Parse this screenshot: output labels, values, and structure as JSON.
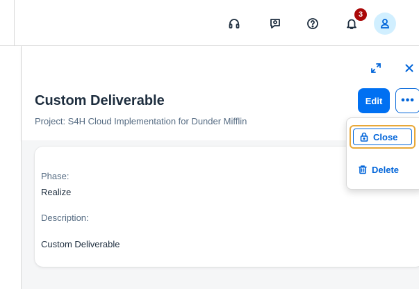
{
  "shellbar": {
    "icons": [
      "headset-icon",
      "feedback-icon",
      "help-icon",
      "notification-bell-icon",
      "user-avatar-icon"
    ],
    "notification_count": "3"
  },
  "header": {
    "title": "Custom Deliverable",
    "subtitle": "Project:  S4H Cloud Implementation for Dunder Mifflin",
    "edit_label": "Edit",
    "more_label": "•••",
    "icons": [
      "expand-icon",
      "close-icon"
    ]
  },
  "menu": {
    "items": [
      {
        "label": "Close",
        "icon": "lock-icon"
      },
      {
        "label": "Delete",
        "icon": "trash-icon"
      }
    ]
  },
  "details": {
    "phase_label": "Phase:",
    "phase_value": "Realize",
    "description_label": "Description:",
    "description_value": "Custom Deliverable"
  },
  "colors": {
    "accent": "#0070f2",
    "link": "#0064d9",
    "badge": "#aa0808",
    "focus": "#e8a838"
  }
}
